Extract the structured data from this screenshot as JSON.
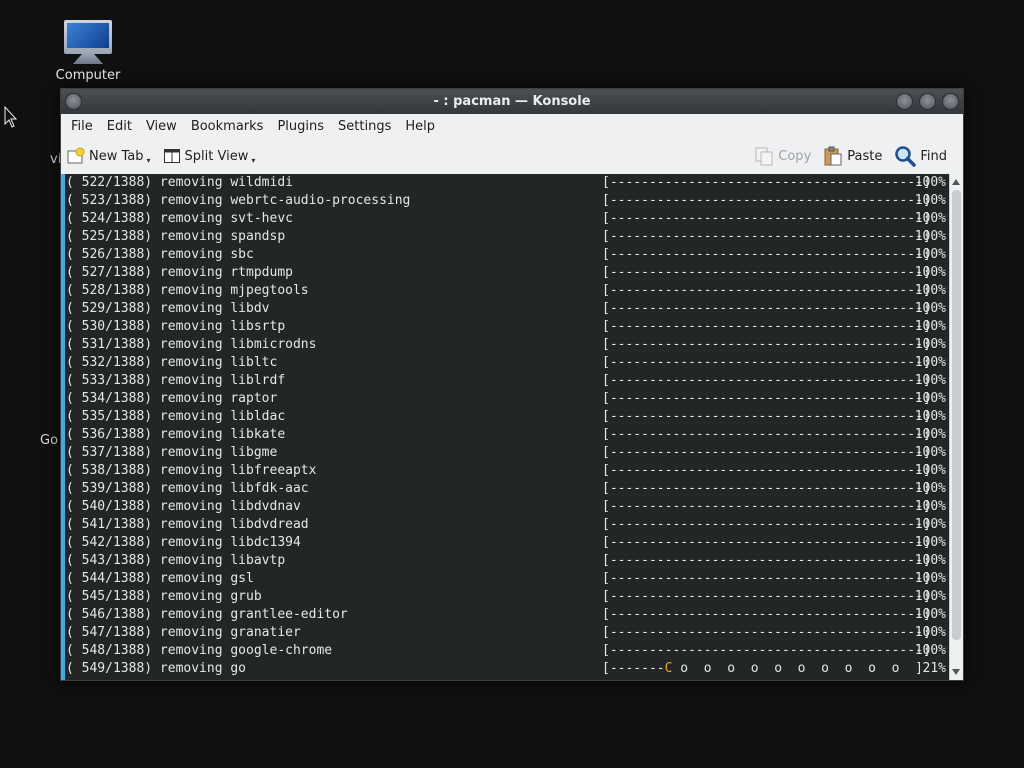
{
  "desktop": {
    "computer_label": "Computer",
    "partial_text_1": "vi",
    "partial_text_2": "Go"
  },
  "window": {
    "title": "- : pacman — Konsole",
    "menu": [
      "File",
      "Edit",
      "View",
      "Bookmarks",
      "Plugins",
      "Settings",
      "Help"
    ],
    "toolbar": {
      "new_tab": "New Tab",
      "split_view": "Split View",
      "copy": "Copy",
      "paste": "Paste",
      "find": "Find"
    }
  },
  "colors": {
    "terminal_bg": "#232627",
    "terminal_fg": "#e6e6e6",
    "accent": "#3daee9",
    "pacman": "#f7a20a"
  },
  "terminal": {
    "lines": [
      {
        "left": "( 522/1388) removing wildmidi",
        "bar": "[----------------------------------------]",
        "pct": "100%"
      },
      {
        "left": "( 523/1388) removing webrtc-audio-processing",
        "bar": "[----------------------------------------]",
        "pct": "100%"
      },
      {
        "left": "( 524/1388) removing svt-hevc",
        "bar": "[----------------------------------------]",
        "pct": "100%"
      },
      {
        "left": "( 525/1388) removing spandsp",
        "bar": "[----------------------------------------]",
        "pct": "100%"
      },
      {
        "left": "( 526/1388) removing sbc",
        "bar": "[----------------------------------------]",
        "pct": "100%"
      },
      {
        "left": "( 527/1388) removing rtmpdump",
        "bar": "[----------------------------------------]",
        "pct": "100%"
      },
      {
        "left": "( 528/1388) removing mjpegtools",
        "bar": "[----------------------------------------]",
        "pct": "100%"
      },
      {
        "left": "( 529/1388) removing libdv",
        "bar": "[----------------------------------------]",
        "pct": "100%"
      },
      {
        "left": "( 530/1388) removing libsrtp",
        "bar": "[----------------------------------------]",
        "pct": "100%"
      },
      {
        "left": "( 531/1388) removing libmicrodns",
        "bar": "[----------------------------------------]",
        "pct": "100%"
      },
      {
        "left": "( 532/1388) removing libltc",
        "bar": "[----------------------------------------]",
        "pct": "100%"
      },
      {
        "left": "( 533/1388) removing liblrdf",
        "bar": "[----------------------------------------]",
        "pct": "100%"
      },
      {
        "left": "( 534/1388) removing raptor",
        "bar": "[----------------------------------------]",
        "pct": "100%"
      },
      {
        "left": "( 535/1388) removing libldac",
        "bar": "[----------------------------------------]",
        "pct": "100%"
      },
      {
        "left": "( 536/1388) removing libkate",
        "bar": "[----------------------------------------]",
        "pct": "100%"
      },
      {
        "left": "( 537/1388) removing libgme",
        "bar": "[----------------------------------------]",
        "pct": "100%"
      },
      {
        "left": "( 538/1388) removing libfreeaptx",
        "bar": "[----------------------------------------]",
        "pct": "100%"
      },
      {
        "left": "( 539/1388) removing libfdk-aac",
        "bar": "[----------------------------------------]",
        "pct": "100%"
      },
      {
        "left": "( 540/1388) removing libdvdnav",
        "bar": "[----------------------------------------]",
        "pct": "100%"
      },
      {
        "left": "( 541/1388) removing libdvdread",
        "bar": "[----------------------------------------]",
        "pct": "100%"
      },
      {
        "left": "( 542/1388) removing libdc1394",
        "bar": "[----------------------------------------]",
        "pct": "100%"
      },
      {
        "left": "( 543/1388) removing libavtp",
        "bar": "[----------------------------------------]",
        "pct": "100%"
      },
      {
        "left": "( 544/1388) removing gsl",
        "bar": "[----------------------------------------]",
        "pct": "100%"
      },
      {
        "left": "( 545/1388) removing grub",
        "bar": "[----------------------------------------]",
        "pct": "100%"
      },
      {
        "left": "( 546/1388) removing grantlee-editor",
        "bar": "[----------------------------------------]",
        "pct": "100%"
      },
      {
        "left": "( 547/1388) removing granatier",
        "bar": "[----------------------------------------]",
        "pct": "100%"
      },
      {
        "left": "( 548/1388) removing google-chrome",
        "bar": "[----------------------------------------]",
        "pct": "100%"
      }
    ],
    "current": {
      "left": "( 549/1388) removing go",
      "bar_open": "[",
      "bar_done": "-------",
      "bar_pacman": "C",
      "bar_rest": " o  o  o  o  o  o  o  o  o  o  ",
      "bar_close": "]",
      "pct": "21%"
    }
  }
}
